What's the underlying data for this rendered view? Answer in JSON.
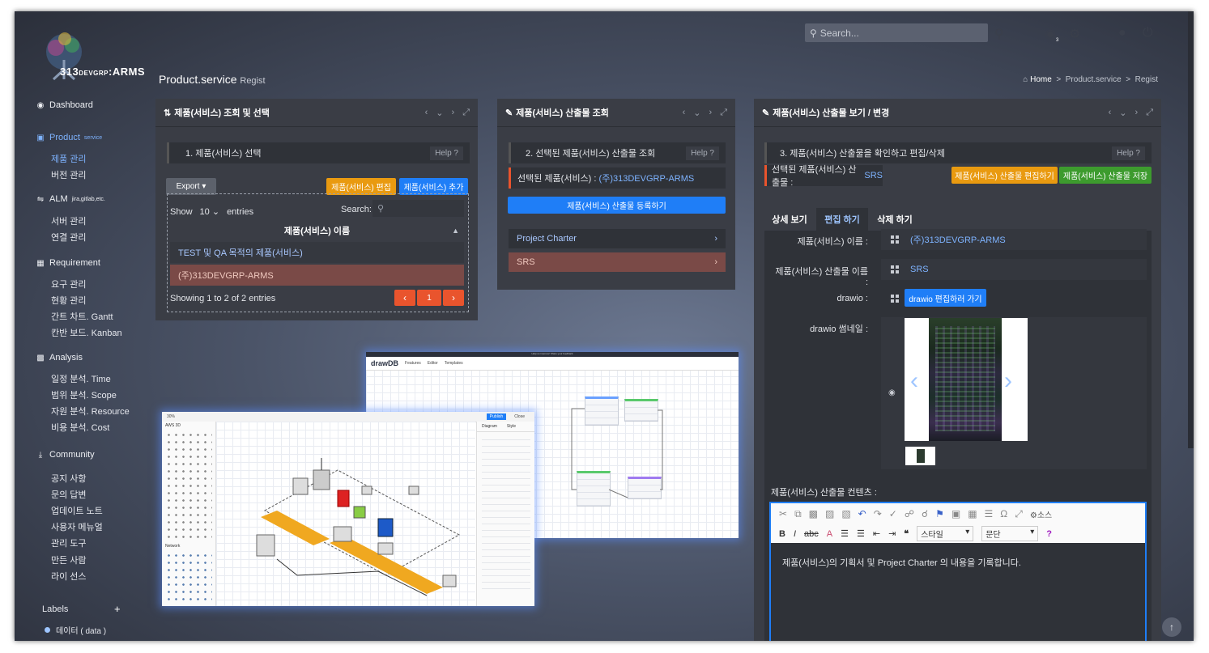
{
  "header": {
    "search_placeholder": "Search...",
    "notification_count": "3"
  },
  "logo": {
    "text_main": "313",
    "text_small": "DEVGRP",
    "text_suffix": ":ARMS"
  },
  "page": {
    "title": "Product.service",
    "subtitle": "Regist"
  },
  "breadcrumb": {
    "home": "Home",
    "section": "Product.service",
    "current": "Regist"
  },
  "sidebar": {
    "dashboard": "Dashboard",
    "product": "Product",
    "product_sup": "service",
    "product_items": [
      "제품 관리",
      "버전 관리"
    ],
    "alm": "ALM",
    "alm_sup": "jira,gitlab,etc.",
    "alm_items": [
      "서버 관리",
      "연결 관리"
    ],
    "requirement": "Requirement",
    "requirement_items": [
      "요구 관리",
      "현황 관리",
      "간트 차트. Gantt",
      "칸반 보드. Kanban"
    ],
    "analysis": "Analysis",
    "analysis_items": [
      "일정 분석. Time",
      "범위 분석. Scope",
      "자원 분석. Resource",
      "비용 분석. Cost"
    ],
    "community": "Community",
    "community_items": [
      "공지 사항",
      "문의 답변",
      "업데이트 노트",
      "사용자 메뉴얼",
      "관리 도구",
      "만든 사람",
      "라이 선스"
    ],
    "labels_title": "Labels",
    "labels_add": "+",
    "label_item": "데이터 ( data )"
  },
  "panel1": {
    "title": "제품(서비스) 조회 및 선택",
    "step": "1. 제품(서비스) 선택",
    "help": "Help",
    "export": "Export",
    "edit_btn": "제품(서비스) 편집",
    "add_btn": "제품(서비스) 추가",
    "show": "Show",
    "entries_value": "10",
    "entries": "entries",
    "search_label": "Search:",
    "col_header": "제품(서비스) 이름",
    "rows": [
      "TEST 및 QA 목적의 제품(서비스)",
      "(주)313DEVGRP-ARMS"
    ],
    "showing": "Showing 1 to 2 of 2 entries",
    "page": "1"
  },
  "panel2": {
    "title": "제품(서비스) 산출물 조회",
    "step": "2. 선택된 제품(서비스) 산출물 조회",
    "help": "Help",
    "selected_label": "선택된 제품(서비스) :",
    "selected_value": "(주)313DEVGRP-ARMS",
    "register_btn": "제품(서비스) 산출물 등록하기",
    "items": [
      "Project Charter",
      "SRS"
    ]
  },
  "panel3": {
    "title": "제품(서비스) 산출물 보기 / 변경",
    "step": "3. 제품(서비스) 산출물을 확인하고 편집/삭제",
    "help": "Help",
    "selected_label": "선택된 제품(서비스) 산출물 :",
    "selected_value": "SRS",
    "edit_btn": "제품(서비스) 산출물 편집하기",
    "save_btn": "제품(서비스) 산출물 저장",
    "tabs": [
      "상세 보기",
      "편집 하기",
      "삭제 하기"
    ],
    "name_label": "제품(서비스) 이름 :",
    "name_value": "(주)313DEVGRP-ARMS",
    "artifact_label": "제품(서비스) 산출물 이름 :",
    "artifact_value": "SRS",
    "drawio_label": "drawio :",
    "drawio_btn": "drawio 편집하러 가기",
    "thumb_label": "drawio 썸네일 :",
    "content_label": "제품(서비스) 산출물 컨텐츠 :",
    "editor_style": "스타일",
    "editor_format": "문단",
    "editor_source": "소스",
    "editor_text": "제품(서비스)의 기획서 및 Project Charter 의 내용을 기록합니다."
  },
  "shots": {
    "drawdb_banner": "Help us improve! Share your feedback",
    "drawdb_logo": "drawDB",
    "drawdb_nav": [
      "Features",
      "Editor",
      "Templates"
    ],
    "drawio_publish": "Publish",
    "drawio_close": "Close",
    "drawio_tabs": [
      "Diagram",
      "Style"
    ],
    "drawio_zoom": "30%",
    "drawio_lib": "AWS 3D",
    "drawio_network": "Network"
  }
}
